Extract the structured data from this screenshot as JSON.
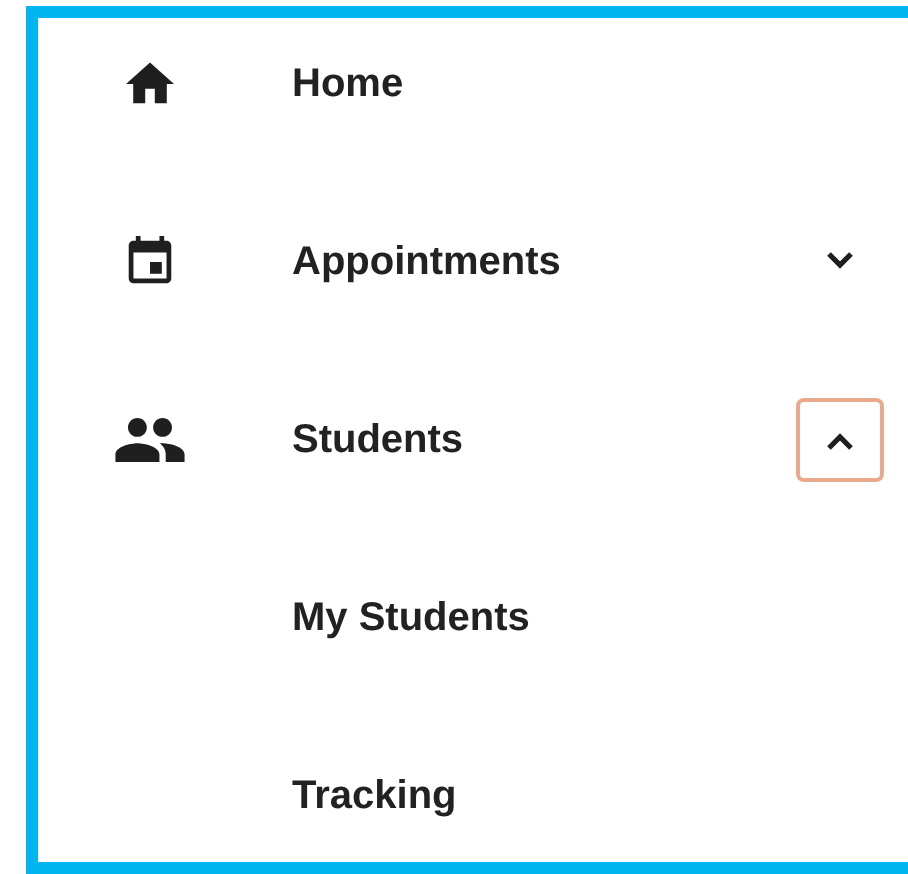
{
  "nav": {
    "items": [
      {
        "label": "Home"
      },
      {
        "label": "Appointments",
        "expanded": false,
        "focused": false
      },
      {
        "label": "Students",
        "expanded": true,
        "focused": true,
        "children": [
          {
            "label": "My Students"
          },
          {
            "label": "Tracking"
          }
        ]
      }
    ]
  }
}
